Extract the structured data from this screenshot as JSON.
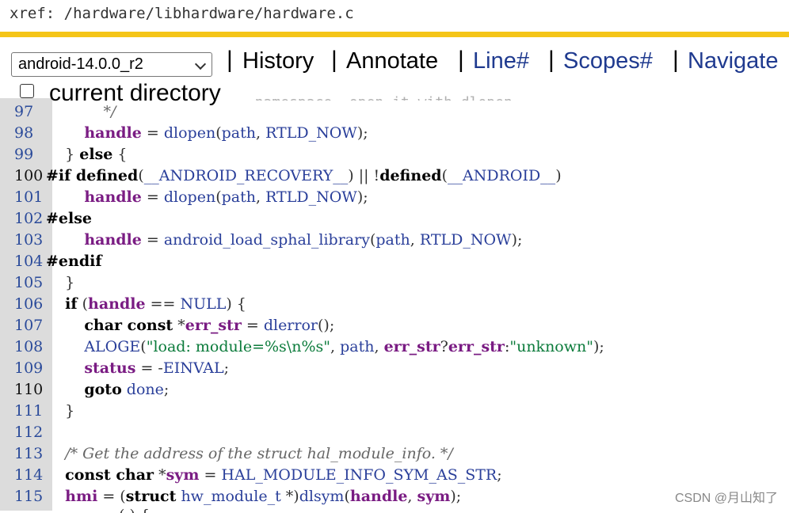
{
  "xref": "xref: /hardware/libhardware/hardware.c",
  "nav": {
    "version_select": "android-14.0.0_r2",
    "history": "History",
    "annotate": "Annotate",
    "line": "Line#",
    "scopes": "Scopes#",
    "navigate": "Navigate",
    "current_directory": "current directory",
    "ghost_text": "namespace. open it with dlopen"
  },
  "watermark": "CSDN @月山知了",
  "colors": {
    "accent_bar": "#f5c518",
    "link": "#1f3a8f",
    "variable": "#7a1c83",
    "gutter": "#dcdcdc"
  },
  "code_lines": [
    {
      "n": "97",
      "tokens": [
        [
          "c",
          "            */"
        ]
      ]
    },
    {
      "n": "98",
      "tokens": [
        [
          "p",
          "        "
        ],
        [
          "v",
          "handle"
        ],
        [
          "p",
          " = "
        ],
        [
          "f",
          "dlopen"
        ],
        [
          "p",
          "("
        ],
        [
          "f",
          "path"
        ],
        [
          "p",
          ", "
        ],
        [
          "f",
          "RTLD_NOW"
        ],
        [
          "p",
          ");"
        ]
      ]
    },
    {
      "n": "99",
      "tokens": [
        [
          "p",
          "    } "
        ],
        [
          "k",
          "else"
        ],
        [
          "p",
          " {"
        ]
      ]
    },
    {
      "n": "100",
      "dark": true,
      "tokens": [
        [
          "k",
          "#if defined"
        ],
        [
          "p",
          "("
        ],
        [
          "f",
          "__ANDROID_RECOVERY__"
        ],
        [
          "p",
          ") || !"
        ],
        [
          "k",
          "defined"
        ],
        [
          "p",
          "("
        ],
        [
          "f",
          "__ANDROID__"
        ],
        [
          "p",
          ")"
        ]
      ]
    },
    {
      "n": "101",
      "tokens": [
        [
          "p",
          "        "
        ],
        [
          "v",
          "handle"
        ],
        [
          "p",
          " = "
        ],
        [
          "f",
          "dlopen"
        ],
        [
          "p",
          "("
        ],
        [
          "f",
          "path"
        ],
        [
          "p",
          ", "
        ],
        [
          "f",
          "RTLD_NOW"
        ],
        [
          "p",
          ");"
        ]
      ]
    },
    {
      "n": "102",
      "tokens": [
        [
          "k",
          "#else"
        ]
      ]
    },
    {
      "n": "103",
      "tokens": [
        [
          "p",
          "        "
        ],
        [
          "v",
          "handle"
        ],
        [
          "p",
          " = "
        ],
        [
          "f",
          "android_load_sphal_library"
        ],
        [
          "p",
          "("
        ],
        [
          "f",
          "path"
        ],
        [
          "p",
          ", "
        ],
        [
          "f",
          "RTLD_NOW"
        ],
        [
          "p",
          ");"
        ]
      ]
    },
    {
      "n": "104",
      "tokens": [
        [
          "k",
          "#endif"
        ]
      ]
    },
    {
      "n": "105",
      "tokens": [
        [
          "p",
          "    }"
        ]
      ]
    },
    {
      "n": "106",
      "tokens": [
        [
          "p",
          "    "
        ],
        [
          "k",
          "if"
        ],
        [
          "p",
          " ("
        ],
        [
          "v",
          "handle"
        ],
        [
          "p",
          " == "
        ],
        [
          "f",
          "NULL"
        ],
        [
          "p",
          ") {"
        ]
      ]
    },
    {
      "n": "107",
      "tokens": [
        [
          "p",
          "        "
        ],
        [
          "k",
          "char const"
        ],
        [
          "p",
          " *"
        ],
        [
          "v",
          "err_str"
        ],
        [
          "p",
          " = "
        ],
        [
          "f",
          "dlerror"
        ],
        [
          "p",
          "();"
        ]
      ]
    },
    {
      "n": "108",
      "tokens": [
        [
          "p",
          "        "
        ],
        [
          "f",
          "ALOGE"
        ],
        [
          "p",
          "("
        ],
        [
          "s",
          "\"load: module=%s\\n%s\""
        ],
        [
          "p",
          ", "
        ],
        [
          "f",
          "path"
        ],
        [
          "p",
          ", "
        ],
        [
          "v",
          "err_str"
        ],
        [
          "p",
          "?"
        ],
        [
          "v",
          "err_str"
        ],
        [
          "p",
          ":"
        ],
        [
          "s",
          "\"unknown\""
        ],
        [
          "p",
          ");"
        ]
      ]
    },
    {
      "n": "109",
      "tokens": [
        [
          "p",
          "        "
        ],
        [
          "v",
          "status"
        ],
        [
          "p",
          " = -"
        ],
        [
          "f",
          "EINVAL"
        ],
        [
          "p",
          ";"
        ]
      ]
    },
    {
      "n": "110",
      "dark": true,
      "tokens": [
        [
          "p",
          "        "
        ],
        [
          "k",
          "goto"
        ],
        [
          "p",
          " "
        ],
        [
          "f",
          "done"
        ],
        [
          "p",
          ";"
        ]
      ]
    },
    {
      "n": "111",
      "tokens": [
        [
          "p",
          "    }"
        ]
      ]
    },
    {
      "n": "112",
      "tokens": []
    },
    {
      "n": "113",
      "tokens": [
        [
          "p",
          "    "
        ],
        [
          "c",
          "/* Get the address of the struct hal_module_info. */"
        ]
      ]
    },
    {
      "n": "114",
      "tokens": [
        [
          "p",
          "    "
        ],
        [
          "k",
          "const char"
        ],
        [
          "p",
          " *"
        ],
        [
          "v",
          "sym"
        ],
        [
          "p",
          " = "
        ],
        [
          "f",
          "HAL_MODULE_INFO_SYM_AS_STR"
        ],
        [
          "p",
          ";"
        ]
      ]
    },
    {
      "n": "115",
      "tokens": [
        [
          "p",
          "    "
        ],
        [
          "v",
          "hmi"
        ],
        [
          "p",
          " = ("
        ],
        [
          "k",
          "struct"
        ],
        [
          "p",
          " "
        ],
        [
          "f",
          "hw_module_t"
        ],
        [
          "p",
          " *)"
        ],
        [
          "f",
          "dlsym"
        ],
        [
          "p",
          "("
        ],
        [
          "v",
          "handle"
        ],
        [
          "p",
          ", "
        ],
        [
          "v",
          "sym"
        ],
        [
          "p",
          ");"
        ]
      ]
    }
  ]
}
